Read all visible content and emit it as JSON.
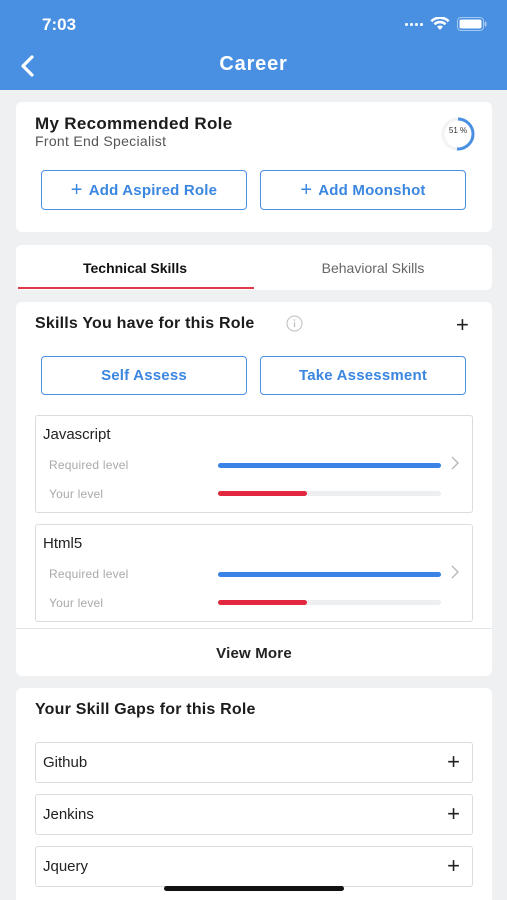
{
  "status_bar": {
    "time": "7:03"
  },
  "header": {
    "title": "Career",
    "back_icon": "chevron-left-icon"
  },
  "recommended_role": {
    "title": "My Recommended Role",
    "role_name": "Front End Specialist",
    "progress_percent": 51,
    "progress_label": "51 %",
    "add_aspired_label": "Add Aspired Role",
    "add_moonshot_label": "Add Moonshot"
  },
  "tabs": [
    {
      "label": "Technical Skills",
      "active": true
    },
    {
      "label": "Behavioral Skills",
      "active": false
    }
  ],
  "skills_section": {
    "title": "Skills You have for this Role",
    "self_assess_label": "Self Assess",
    "take_assessment_label": "Take Assessment",
    "required_label": "Required level",
    "your_label": "Your level",
    "skills": [
      {
        "name": "Javascript",
        "required_level": 1.0,
        "your_level": 0.4
      },
      {
        "name": "Html5",
        "required_level": 1.0,
        "your_level": 0.4
      }
    ],
    "view_more_label": "View More"
  },
  "skill_gaps": {
    "title": "Your Skill Gaps for this Role",
    "items": [
      "Github",
      "Jenkins",
      "Jquery"
    ]
  },
  "colors": {
    "accent": "#4a90e2",
    "required_bar": "#3b82e6",
    "your_bar": "#e2283e",
    "tab_indicator": "#e0394a"
  }
}
